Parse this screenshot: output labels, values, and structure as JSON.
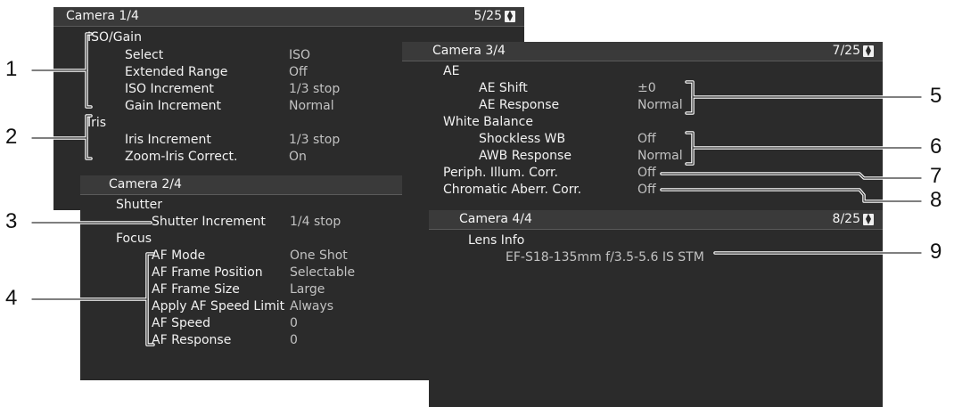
{
  "panel1": {
    "title": "Camera 1/4",
    "page": "5/25",
    "items": [
      {
        "label": "ISO/Gain"
      },
      {
        "label": "Select",
        "value": "ISO"
      },
      {
        "label": "Extended Range",
        "value": "Off"
      },
      {
        "label": "ISO Increment",
        "value": "1/3 stop"
      },
      {
        "label": "Gain Increment",
        "value": "Normal"
      },
      {
        "label": "Iris"
      },
      {
        "label": "Iris Increment",
        "value": "1/3 stop"
      },
      {
        "label": "Zoom-Iris Correct.",
        "value": "On"
      }
    ]
  },
  "panel2": {
    "title": "Camera 2/4",
    "items": [
      {
        "label": "Shutter"
      },
      {
        "label": "Shutter Increment",
        "value": "1/4 stop"
      },
      {
        "label": "Focus"
      },
      {
        "label": "AF Mode",
        "value": "One Shot"
      },
      {
        "label": "AF Frame Position",
        "value": "Selectable"
      },
      {
        "label": "AF Frame Size",
        "value": "Large"
      },
      {
        "label": "Apply AF Speed Limit",
        "value": "Always"
      },
      {
        "label": "AF Speed",
        "value": "0"
      },
      {
        "label": "AF Response",
        "value": "0"
      }
    ]
  },
  "panel3": {
    "title": "Camera 3/4",
    "page": "7/25",
    "items": [
      {
        "label": "AE"
      },
      {
        "label": "AE Shift",
        "value": "±0"
      },
      {
        "label": "AE Response",
        "value": "Normal"
      },
      {
        "label": "White Balance"
      },
      {
        "label": "Shockless WB",
        "value": "Off"
      },
      {
        "label": "AWB Response",
        "value": "Normal"
      },
      {
        "label": "Periph. Illum. Corr.",
        "value": "Off"
      },
      {
        "label": "Chromatic Aberr. Corr.",
        "value": "Off"
      }
    ]
  },
  "panel4": {
    "title": "Camera 4/4",
    "page": "8/25",
    "items": [
      {
        "label": "Lens Info"
      },
      {
        "value": "EF-S18-135mm f/3.5-5.6 IS STM"
      }
    ]
  },
  "callouts": [
    "1",
    "2",
    "3",
    "4",
    "5",
    "6",
    "7",
    "8",
    "9"
  ],
  "icons": {
    "scroll": "up-down-scroll-icon"
  }
}
